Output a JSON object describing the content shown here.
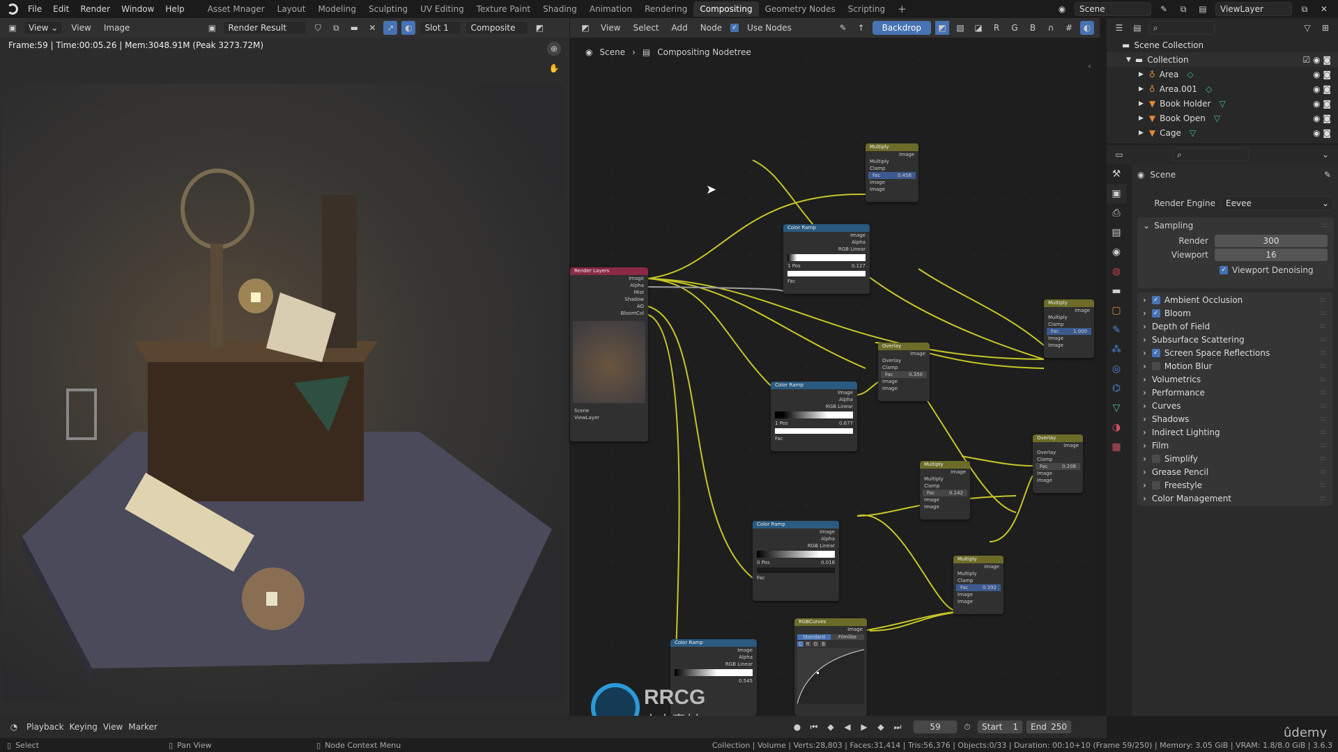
{
  "topbar": {
    "menus": [
      "File",
      "Edit",
      "Render",
      "Window",
      "Help"
    ],
    "workspaces": [
      "Asset Mnager",
      "Layout",
      "Modeling",
      "Sculpting",
      "UV Editing",
      "Texture Paint",
      "Shading",
      "Animation",
      "Rendering",
      "Compositing",
      "Geometry Nodes",
      "Scripting"
    ],
    "active_workspace": "Compositing",
    "add_workspace": "+",
    "scene": "Scene",
    "view_layer": "ViewLayer"
  },
  "image_editor": {
    "view_menu": "View",
    "menus": [
      "View",
      "Image"
    ],
    "image_name": "Render Result",
    "slot": "Slot 1",
    "layer": "Composite",
    "status": "Frame:59 | Time:00:05.26 | Mem:3048.91M (Peak 3273.72M)"
  },
  "node_editor": {
    "menus": [
      "View",
      "Select",
      "Add",
      "Node"
    ],
    "use_nodes_label": "Use Nodes",
    "use_nodes": true,
    "backdrop_label": "Backdrop",
    "channels": [
      "R",
      "G",
      "B"
    ],
    "breadcrumb": [
      "Scene",
      "Compositing Nodetree"
    ],
    "nodes": {
      "render_layers": {
        "title": "Render Layers",
        "outputs": [
          "Image",
          "Alpha",
          "Mist",
          "Shadow",
          "AO",
          "BloomCol"
        ],
        "scene": "Scene",
        "layer": "ViewLayer"
      },
      "multiply1": {
        "title": "Multiply",
        "output": "Image",
        "blend": "Multiply",
        "clamp": "Clamp",
        "fac_label": "Fac",
        "fac": "0.458",
        "inputs": [
          "Image",
          "Image"
        ]
      },
      "colorramp1": {
        "title": "Color Ramp",
        "outputs": [
          "Image",
          "Alpha"
        ],
        "mode": "RGB",
        "interp": "Linear",
        "index": "1",
        "pos_label": "Pos",
        "pos": "0.127",
        "input": "Fac"
      },
      "overlay1": {
        "title": "Overlay",
        "output": "Image",
        "blend": "Overlay",
        "clamp": "Clamp",
        "fac_label": "Fac",
        "fac": "0.350",
        "inputs": [
          "Image",
          "Image"
        ]
      },
      "multiply2": {
        "title": "Multiply",
        "output": "Image",
        "blend": "Multiply",
        "clamp": "Clamp",
        "fac_label": "Fac",
        "fac": "1.000",
        "inputs": [
          "Image",
          "Image"
        ]
      },
      "colorramp2": {
        "title": "Color Ramp",
        "outputs": [
          "Image",
          "Alpha"
        ],
        "mode": "RGB",
        "interp": "Linear",
        "index": "1",
        "pos_label": "Pos",
        "pos": "0.677",
        "input": "Fac"
      },
      "overlay2": {
        "title": "Overlay",
        "output": "Image",
        "blend": "Overlay",
        "clamp": "Clamp",
        "fac_label": "Fac",
        "fac": "0.208",
        "inputs": [
          "Image",
          "Image"
        ]
      },
      "multiply3": {
        "title": "Multiply",
        "output": "Image",
        "blend": "Multiply",
        "clamp": "Clamp",
        "fac_label": "Fac",
        "fac": "0.142",
        "inputs": [
          "Image",
          "Image"
        ]
      },
      "colorramp3": {
        "title": "Color Ramp",
        "outputs": [
          "Image",
          "Alpha"
        ],
        "mode": "RGB",
        "interp": "Linear",
        "index": "0",
        "pos_label": "Pos",
        "pos": "0.018",
        "input": "Fac"
      },
      "multiply4": {
        "title": "Multiply",
        "output": "Image",
        "blend": "Multiply",
        "clamp": "Clamp",
        "fac_label": "Fac",
        "fac": "0.392",
        "inputs": [
          "Image",
          "Image"
        ]
      },
      "colorramp4": {
        "title": "Color Ramp",
        "outputs": [
          "Image",
          "Alpha"
        ],
        "mode": "RGB",
        "interp": "Linear",
        "pos": "0.545"
      },
      "rgbcurves": {
        "title": "RGBCurves",
        "output": "Image",
        "tabs": [
          "Standard",
          "Filmlike"
        ],
        "channels": [
          "C",
          "R",
          "G",
          "B"
        ]
      }
    }
  },
  "outliner": {
    "root": "Scene Collection",
    "collection": "Collection",
    "items": [
      "Area",
      "Area.001",
      "Book Holder",
      "Book Open",
      "Cage"
    ]
  },
  "properties": {
    "context": "Scene",
    "render_engine_label": "Render Engine",
    "render_engine": "Eevee",
    "sampling": {
      "label": "Sampling",
      "render_label": "Render",
      "render": "300",
      "viewport_label": "Viewport",
      "viewport": "16",
      "denoise_label": "Viewport Denoising",
      "denoise": true
    },
    "panels": [
      {
        "label": "Ambient Occlusion",
        "checkbox": true,
        "checked": true
      },
      {
        "label": "Bloom",
        "checkbox": true,
        "checked": true
      },
      {
        "label": "Depth of Field",
        "checkbox": false
      },
      {
        "label": "Subsurface Scattering",
        "checkbox": false
      },
      {
        "label": "Screen Space Reflections",
        "checkbox": true,
        "checked": true
      },
      {
        "label": "Motion Blur",
        "checkbox": true,
        "checked": false
      },
      {
        "label": "Volumetrics",
        "checkbox": false
      },
      {
        "label": "Performance",
        "checkbox": false
      },
      {
        "label": "Curves",
        "checkbox": false
      },
      {
        "label": "Shadows",
        "checkbox": false
      },
      {
        "label": "Indirect Lighting",
        "checkbox": false
      },
      {
        "label": "Film",
        "checkbox": false
      },
      {
        "label": "Simplify",
        "checkbox": true,
        "checked": false
      },
      {
        "label": "Grease Pencil",
        "checkbox": false
      },
      {
        "label": "Freestyle",
        "checkbox": true,
        "checked": false
      },
      {
        "label": "Color Management",
        "checkbox": false
      }
    ]
  },
  "timeline": {
    "menus": [
      "Playback",
      "Keying",
      "View",
      "Marker"
    ],
    "current_frame": "59",
    "start_label": "Start",
    "start": "1",
    "end_label": "End",
    "end": "250"
  },
  "statusbar": {
    "hints": [
      "Select",
      "Pan View",
      "Node Context Menu"
    ],
    "info": "Collection | Volume | Verts:28,803 | Faces:31,414 | Tris:56,376 | Objects:0/33 | Duration: 00:10+10 (Frame 59/250) | Memory: 3.05 GiB | VRAM: 1.8/8.0 GiB | 3.6.3"
  },
  "watermarks": {
    "rrcg": "RRCG",
    "rrcg_sub": "人人素材",
    "udemy": "ûdemy"
  }
}
